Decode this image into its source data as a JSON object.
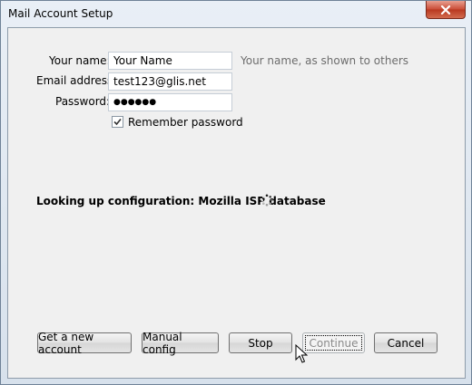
{
  "window": {
    "title": "Mail Account Setup"
  },
  "form": {
    "name_label": "Your name:",
    "name_value": "Your Name",
    "name_hint": "Your name, as shown to others",
    "email_label": "Email address:",
    "email_value": "test123@glis.net",
    "password_label": "Password:",
    "password_value": "●●●●●●",
    "remember_label": "Remember password",
    "remember_checked": true
  },
  "status": {
    "text": "Looking up configuration: Mozilla ISP database"
  },
  "buttons": {
    "new_account": "Get a new account",
    "manual_config": "Manual config",
    "stop": "Stop",
    "continue": "Continue",
    "cancel": "Cancel"
  },
  "colors": {
    "close_button": "#c94a34",
    "client_bg": "#f0f0f0",
    "hint_text": "#6d6d6d"
  }
}
